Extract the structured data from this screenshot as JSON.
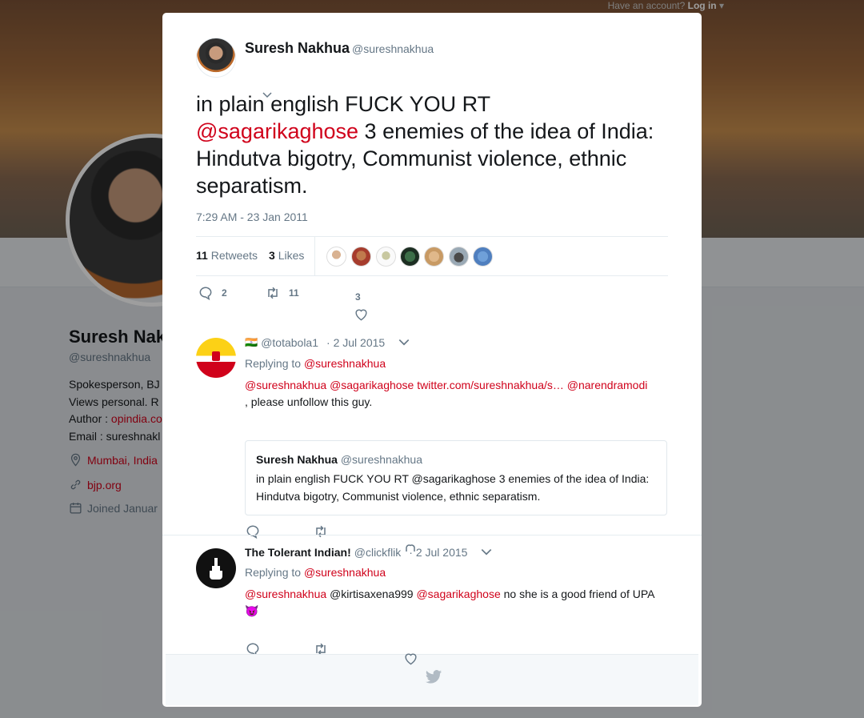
{
  "background": {
    "topbar_text": "Have an account?",
    "topbar_login": "Log in",
    "profile_name": "Suresh Nakh",
    "profile_handle": "@sureshnakhua",
    "bio_line1": "Spokesperson, BJ",
    "bio_line2": "Views personal. R",
    "bio_line3_prefix": "Author : ",
    "bio_line3_link": "opindia.co",
    "bio_line4": "Email : sureshnakl",
    "location": "Mumbai, India",
    "website": "bjp.org",
    "joined": "Joined Januar"
  },
  "tweet": {
    "name": "Suresh Nakhua",
    "handle": "@sureshnakhua",
    "text_prefix": "in plain english FUCK YOU RT",
    "mention": "@sagarikaghose",
    "text_suffix": "3 enemies of the idea of India: Hindutva bigotry, Communist violence, ethnic separatism.",
    "timestamp": "7:29 AM - 23 Jan 2011",
    "retweets_count": "11",
    "retweets_label": "Retweets",
    "likes_count": "3",
    "likes_label": "Likes",
    "reply_count": "2",
    "retweet_action_count": "11",
    "like_action_count": "3"
  },
  "replies": [
    {
      "flag": "🇮🇳",
      "handle": "@totabola1",
      "date": "· 2 Jul 2015",
      "replying_to_label": "Replying to",
      "replying_to": "@sureshnakhua",
      "m1": "@sureshnakhua",
      "m2": "@sagarikaghose",
      "link": "twitter.com/sureshnakhua/s…",
      "m3": "@narendramodi",
      "text_tail": ", please unfollow this guy.",
      "quote_name": "Suresh Nakhua",
      "quote_handle": "@sureshnakhua",
      "quote_text": "in plain english FUCK YOU RT @sagarikaghose 3 enemies of the idea of India: Hindutva bigotry, Communist violence, ethnic separatism."
    },
    {
      "name": "The Tolerant Indian!",
      "handle": "@clickflik",
      "date": "· 2 Jul 2015",
      "replying_to_label": "Replying to",
      "replying_to": "@sureshnakhua",
      "m1": "@sureshnakhua",
      "plain1": "@kirtisaxena999",
      "m2": "@sagarikaghose",
      "text_tail": "no she is a good friend of UPA",
      "emoji": "😈"
    }
  ],
  "colors": {
    "mention": "#d0021b",
    "secondary_text": "#657786",
    "primary_text": "#14171a"
  },
  "icons": [
    "reply-icon",
    "retweet-icon",
    "like-icon",
    "chevron-down-icon",
    "twitter-bird-icon",
    "location-icon",
    "link-icon",
    "calendar-icon"
  ]
}
